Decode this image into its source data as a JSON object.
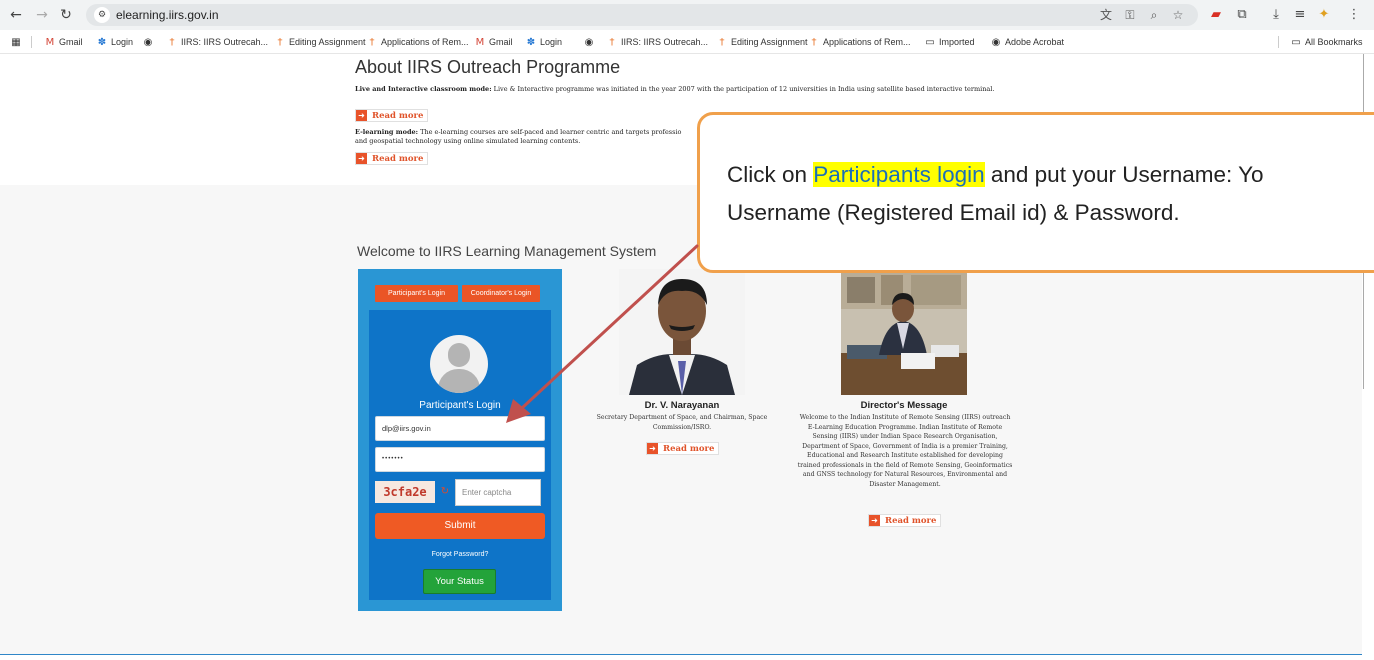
{
  "browser": {
    "url": "elearning.iirs.gov.in",
    "bookmarks": [
      {
        "label": "Gmail",
        "icon": "gmail-icon"
      },
      {
        "label": "Login",
        "icon": "login-icon"
      },
      {
        "label": "",
        "icon": "globe-icon"
      },
      {
        "label": "IIRS: IIRS Outrecah...",
        "icon": "isro-icon"
      },
      {
        "label": "Editing Assignment",
        "icon": "isro-icon"
      },
      {
        "label": "Applications of Rem...",
        "icon": "isro-icon"
      },
      {
        "label": "Gmail",
        "icon": "gmail-icon"
      },
      {
        "label": "Login",
        "icon": "login-icon"
      },
      {
        "label": "",
        "icon": "globe-icon"
      },
      {
        "label": "IIRS: IIRS Outrecah...",
        "icon": "isro-icon"
      },
      {
        "label": "Editing Assignment",
        "icon": "isro-icon"
      },
      {
        "label": "Applications of Rem...",
        "icon": "isro-icon"
      },
      {
        "label": "Imported",
        "icon": "folder-icon"
      },
      {
        "label": "Adobe Acrobat",
        "icon": "globe-icon"
      }
    ],
    "all_bookmarks": "All Bookmarks"
  },
  "about": {
    "title": "About IIRS Outreach Programme",
    "live_label": "Live and Interactive classroom mode:",
    "live_text": " Live & Interactive programme was initiated in the year 2007 with the participation of 12 universities in India using satellite based interactive terminal.",
    "elearning_label": "E-learning mode:",
    "elearning_text": " The e-learning courses are self-paced and learner centric and targets professio",
    "elearning_text2": "and geospatial technology using online simulated learning contents.",
    "read_more": "Read more"
  },
  "welcome": "Welcome to IIRS Learning Management System",
  "login": {
    "tab_participant": "Participant's Login",
    "tab_coordinator": "Coordinator's Login",
    "title": "Participant's Login",
    "username_value": "dlp@iirs.gov.in",
    "password_value": "•••••••",
    "captcha": "3cfa2e",
    "captcha_placeholder": "Enter captcha",
    "submit": "Submit",
    "forgot": "Forgot Password?",
    "status": "Your Status"
  },
  "chairman": {
    "name": "Dr. V. Narayanan",
    "desc": "Secretary Department of Space, and Chairman, Space Commission/ISRO.",
    "read_more": "Read more"
  },
  "director": {
    "name": "Director's Message",
    "desc": "Welcome to the Indian Institute of Remote Sensing (IIRS) outreach E-Learning Education Programme. Indian Institute of Remote Sensing (IIRS) under Indian Space Research Organisation, Department of Space, Government of India is a premier Training, Educational and Research Institute established for developing trained professionals in the field of Remote Sensing, Geoinformatics and GNSS technology for Natural Resources, Environmental and Disaster Management.",
    "read_more": "Read more"
  },
  "callout": {
    "pre": "Click on ",
    "highlight": "Participants login",
    "post": " and put your Username:  Yo",
    "line2": "Username (Registered Email id) & Password."
  },
  "colors": {
    "accent_orange": "#ea5526",
    "login_blue": "#0e74c8",
    "status_green": "#23a33a",
    "callout_border": "#f0a04b",
    "arrow": "#c0504d"
  }
}
